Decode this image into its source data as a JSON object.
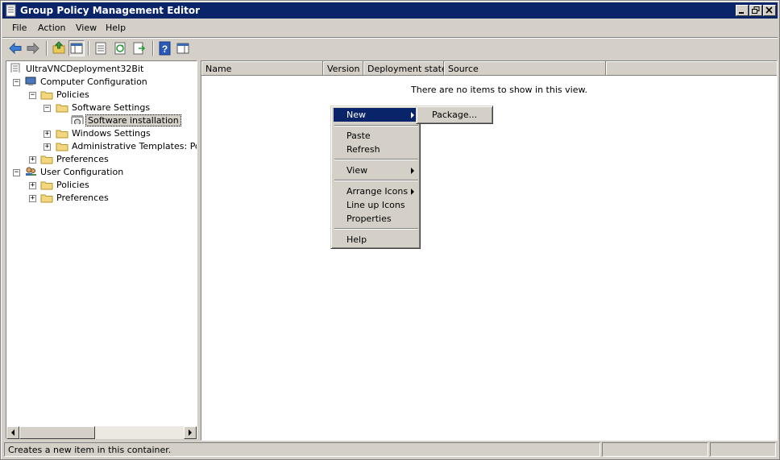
{
  "window": {
    "title": "Group Policy Management Editor",
    "title_bar_color": "#0a246a",
    "buttons": [
      "minimize-icon",
      "restore-icon",
      "close-icon"
    ]
  },
  "menubar": {
    "items": [
      {
        "label": "File"
      },
      {
        "label": "Action"
      },
      {
        "label": "View"
      },
      {
        "label": "Help"
      }
    ]
  },
  "toolbar": {
    "icons": [
      "back-arrow-icon",
      "forward-arrow-icon",
      "up-folder-icon",
      "show-hide-console-tree-icon",
      "properties-icon",
      "refresh-icon",
      "export-list-icon",
      "help-icon",
      "show-action-pane-icon"
    ]
  },
  "tree": {
    "root": "UltraVNCDeployment32Bit",
    "nodes": [
      {
        "label": "Computer Configuration",
        "expanded": true
      },
      {
        "label": "Policies",
        "expanded": true
      },
      {
        "label": "Software Settings",
        "expanded": true
      },
      {
        "label": "Software installation",
        "selected": true
      },
      {
        "label": "Windows Settings",
        "expanded": false
      },
      {
        "label": "Administrative Templates: Policy",
        "expanded": false
      },
      {
        "label": "Preferences",
        "expanded": false
      },
      {
        "label": "User Configuration",
        "expanded": true
      },
      {
        "label": "Policies",
        "expanded": false
      },
      {
        "label": "Preferences",
        "expanded": false
      }
    ]
  },
  "list": {
    "columns": [
      "Name",
      "Version",
      "Deployment state",
      "Source"
    ],
    "empty_message": "There are no items to show in this view."
  },
  "context_menu": {
    "items": [
      {
        "label": "New",
        "submenu": true,
        "highlighted": true
      },
      {
        "label": "Paste"
      },
      {
        "label": "Refresh"
      },
      {
        "label": "View",
        "submenu": true
      },
      {
        "label": "Arrange Icons",
        "submenu": true
      },
      {
        "label": "Line up Icons"
      },
      {
        "label": "Properties"
      },
      {
        "label": "Help"
      }
    ],
    "highlight_color": "#0a246a"
  },
  "submenu": {
    "items": [
      {
        "label": "Package..."
      }
    ]
  },
  "statusbar": {
    "text": "Creates a new item in this container."
  }
}
